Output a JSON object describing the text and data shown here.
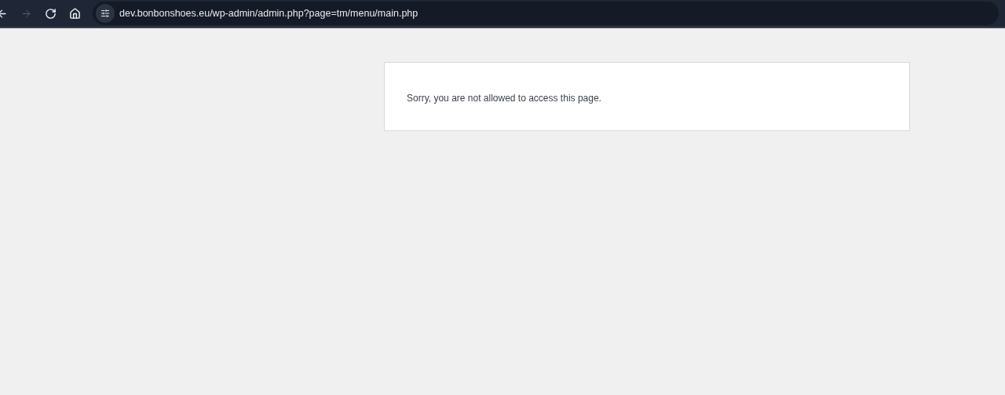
{
  "browser": {
    "nav_buttons": [
      {
        "kind": "back",
        "disabled": false
      },
      {
        "kind": "forward",
        "disabled": true
      },
      {
        "kind": "reload",
        "disabled": false
      },
      {
        "kind": "home",
        "disabled": false
      }
    ],
    "address": "dev.bonbonshoes.eu/wp-admin/admin.php?page=tm/menu/main.php"
  },
  "page": {
    "message": "Sorry, you are not allowed to access this page."
  }
}
